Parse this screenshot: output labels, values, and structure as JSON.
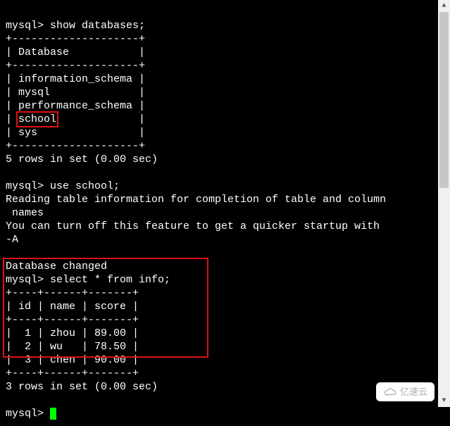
{
  "prompt": "mysql>",
  "commands": {
    "show_db": "show databases;",
    "use_db": "use school;",
    "select_info": "select * from info;"
  },
  "db_border_top": "+--------------------+",
  "db_header": "| Database           |",
  "databases": [
    "| information_schema |",
    "| mysql              |",
    "| performance_schema |",
    "| school             |",
    "| sys                |"
  ],
  "db_highlight_name": "school",
  "db_result_msg": "5 rows in set (0.00 sec)",
  "use_output_line1": "Reading table information for completion of table and column",
  "use_output_line1b": " names",
  "use_output_line2": "You can turn off this feature to get a quicker startup with ",
  "use_output_line2b": "-A",
  "db_changed": "Database changed",
  "info_border": "+----+------+-------+",
  "info_header": "| id | name | score |",
  "info_rows": [
    "|  1 | zhou | 89.00 |",
    "|  2 | wu   | 78.50 |",
    "|  3 | chen | 90.00 |"
  ],
  "info_result_msg": "3 rows in set (0.00 sec)",
  "watermark_text": "亿速云",
  "chart_data": {
    "type": "table",
    "columns": [
      "id",
      "name",
      "score"
    ],
    "rows": [
      {
        "id": 1,
        "name": "zhou",
        "score": 89.0
      },
      {
        "id": 2,
        "name": "wu",
        "score": 78.5
      },
      {
        "id": 3,
        "name": "chen",
        "score": 90.0
      }
    ]
  }
}
